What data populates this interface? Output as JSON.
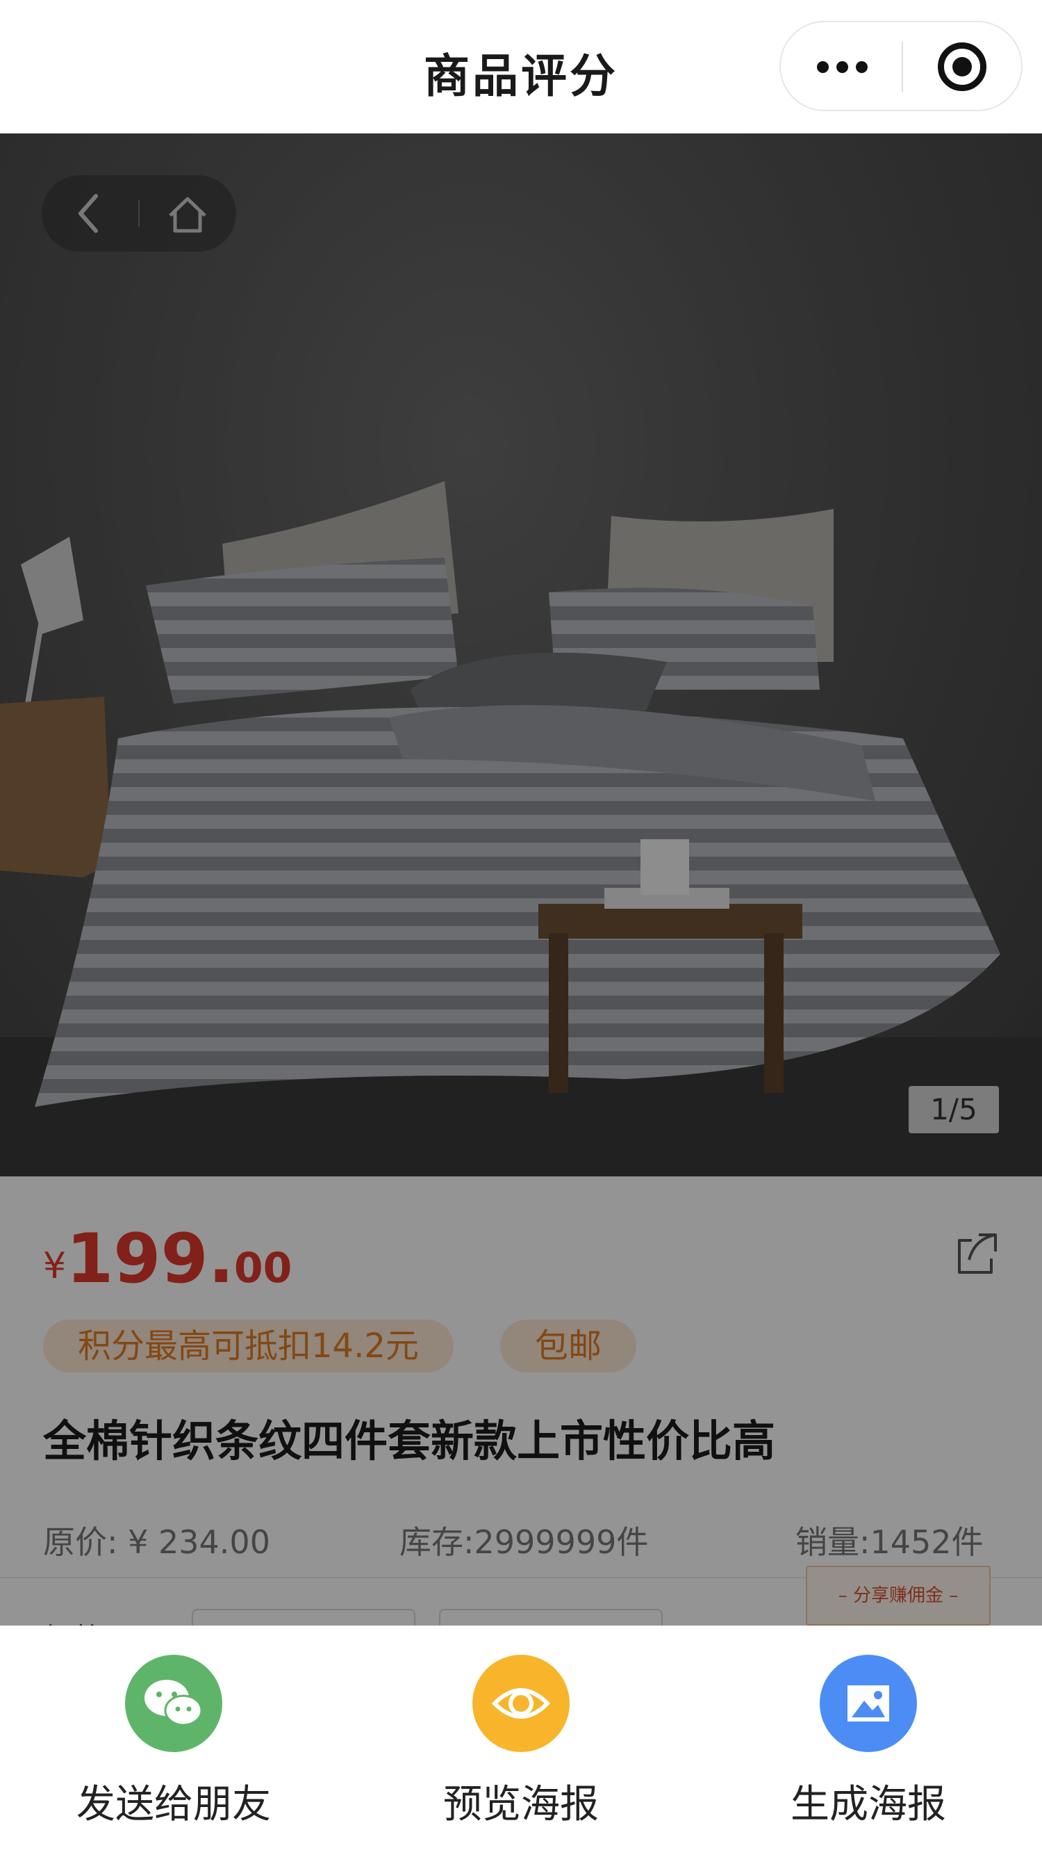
{
  "navbar": {
    "title": "商品评分"
  },
  "hero": {
    "image_counter": "1/5"
  },
  "product": {
    "price_currency": "¥",
    "price_integer": "199.",
    "price_decimal": "00",
    "tags": {
      "points": "积分最高可抵扣14.2元",
      "shipping": "包邮"
    },
    "title": "全棉针织条纹四件套新款上市性价比高",
    "original_price": "原价: ¥ 234.00",
    "stock": "库存:2999999件",
    "sales": "销量:1452件",
    "promo_badge": "– 分享赚佣金 –",
    "spec_label": "规格"
  },
  "share_sheet": {
    "actions": [
      {
        "label": "发送给朋友",
        "icon": "wechat-icon",
        "color": "#5eb56a"
      },
      {
        "label": "预览海报",
        "icon": "eye-icon",
        "color": "#f8b52b"
      },
      {
        "label": "生成海报",
        "icon": "image-icon",
        "color": "#4b8df5"
      }
    ]
  },
  "colors": {
    "price": "#e0392b",
    "tag_text": "#e27c22",
    "tag_bg": "#fde7d5"
  }
}
